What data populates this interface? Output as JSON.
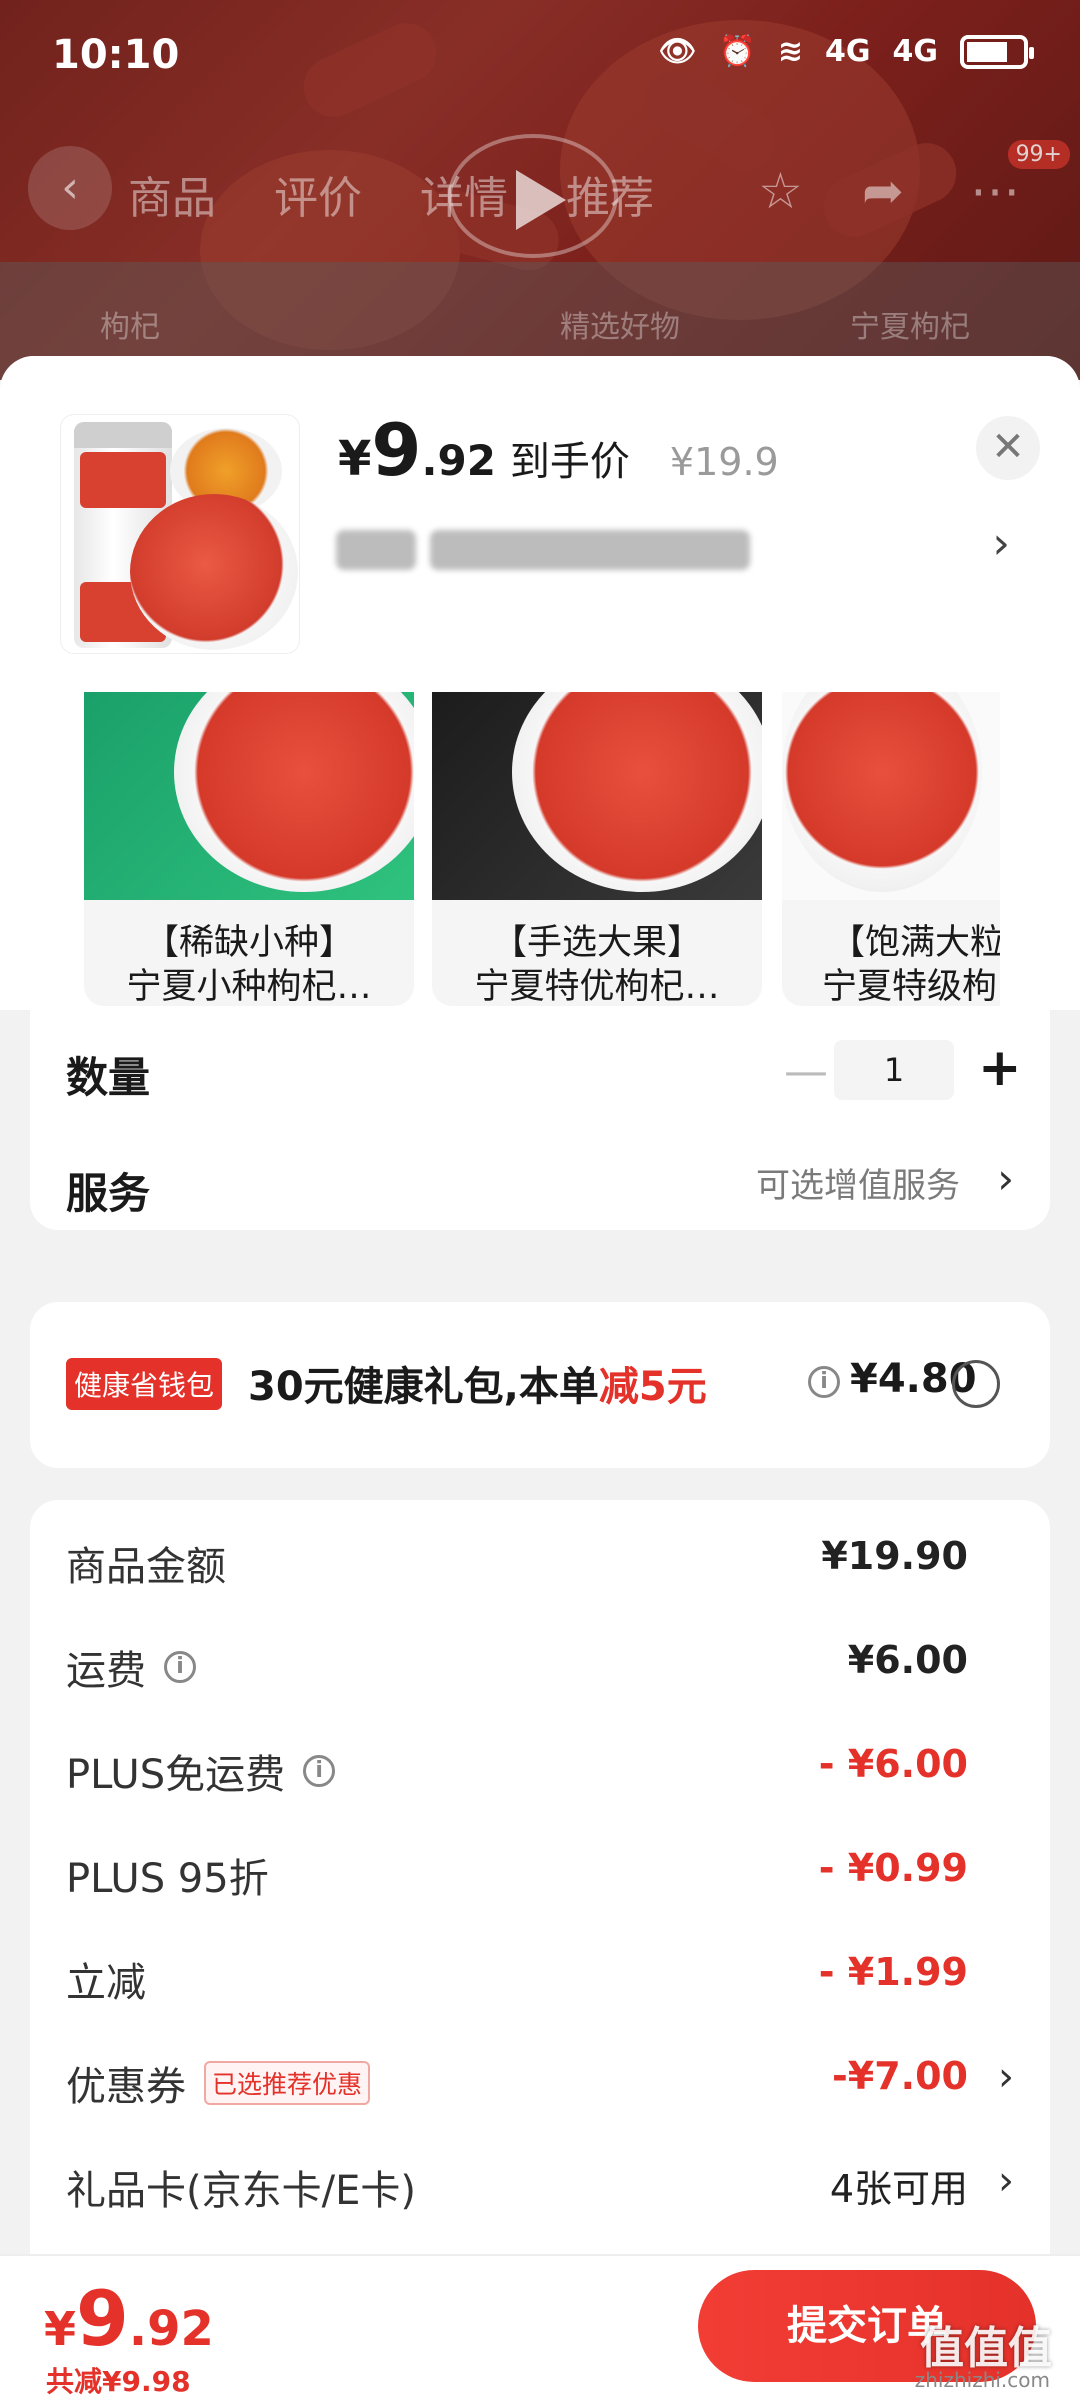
{
  "status_bar": {
    "time": "10:10",
    "signal1": "4G",
    "signal2": "4G"
  },
  "top_nav": {
    "tabs": [
      "商品",
      "评价",
      "详情",
      "推荐"
    ],
    "badge": "99+"
  },
  "background": {
    "sub_left": "枸杞",
    "sub_mid": "精选好物",
    "sub_right": "宁夏枸杞"
  },
  "product": {
    "price_yen": "¥",
    "price_int": "9",
    "price_dec": ".92",
    "price_label": "到手价",
    "original_price": "¥19.9"
  },
  "variants": [
    {
      "line1": "【稀缺小种】",
      "line2": "宁夏小种枸杞…"
    },
    {
      "line1": "【手选大果】",
      "line2": "宁夏特优枸杞…"
    },
    {
      "line1": "【饱满大粒",
      "line2": "宁夏特级枸"
    }
  ],
  "quantity": {
    "label": "数量",
    "value": "1"
  },
  "service": {
    "label": "服务",
    "value": "可选增值服务"
  },
  "promo": {
    "badge": "健康省钱包",
    "text_main": "30元健康礼包,本单",
    "text_highlight": "减5元",
    "price": "¥4.80"
  },
  "summary": [
    {
      "key": "商品金额",
      "value": "¥19.90",
      "red": false,
      "info": false
    },
    {
      "key": "运费",
      "value": "¥6.00",
      "red": false,
      "info": true
    },
    {
      "key": "PLUS免运费",
      "value": "- ¥6.00",
      "red": true,
      "info": true
    },
    {
      "key": "PLUS 95折",
      "value": "- ¥0.99",
      "red": true,
      "info": false
    },
    {
      "key": "立减",
      "value": "- ¥1.99",
      "red": true,
      "info": false
    },
    {
      "key": "优惠券",
      "tag": "已选推荐优惠",
      "value": "-¥7.00",
      "red": true,
      "info": false
    },
    {
      "key": "礼品卡(京东卡/E卡)",
      "value": "4张可用",
      "red": false,
      "info": false
    }
  ],
  "bottom_bar": {
    "total_yen": "¥",
    "total_int": "9",
    "total_dec": ".92",
    "saved": "共减¥9.98",
    "submit_label": "提交订单",
    "watermark": "值值值",
    "watermark_url": "zhizhizhi.com"
  },
  "colors": {
    "accent_red": "#e4312a"
  }
}
